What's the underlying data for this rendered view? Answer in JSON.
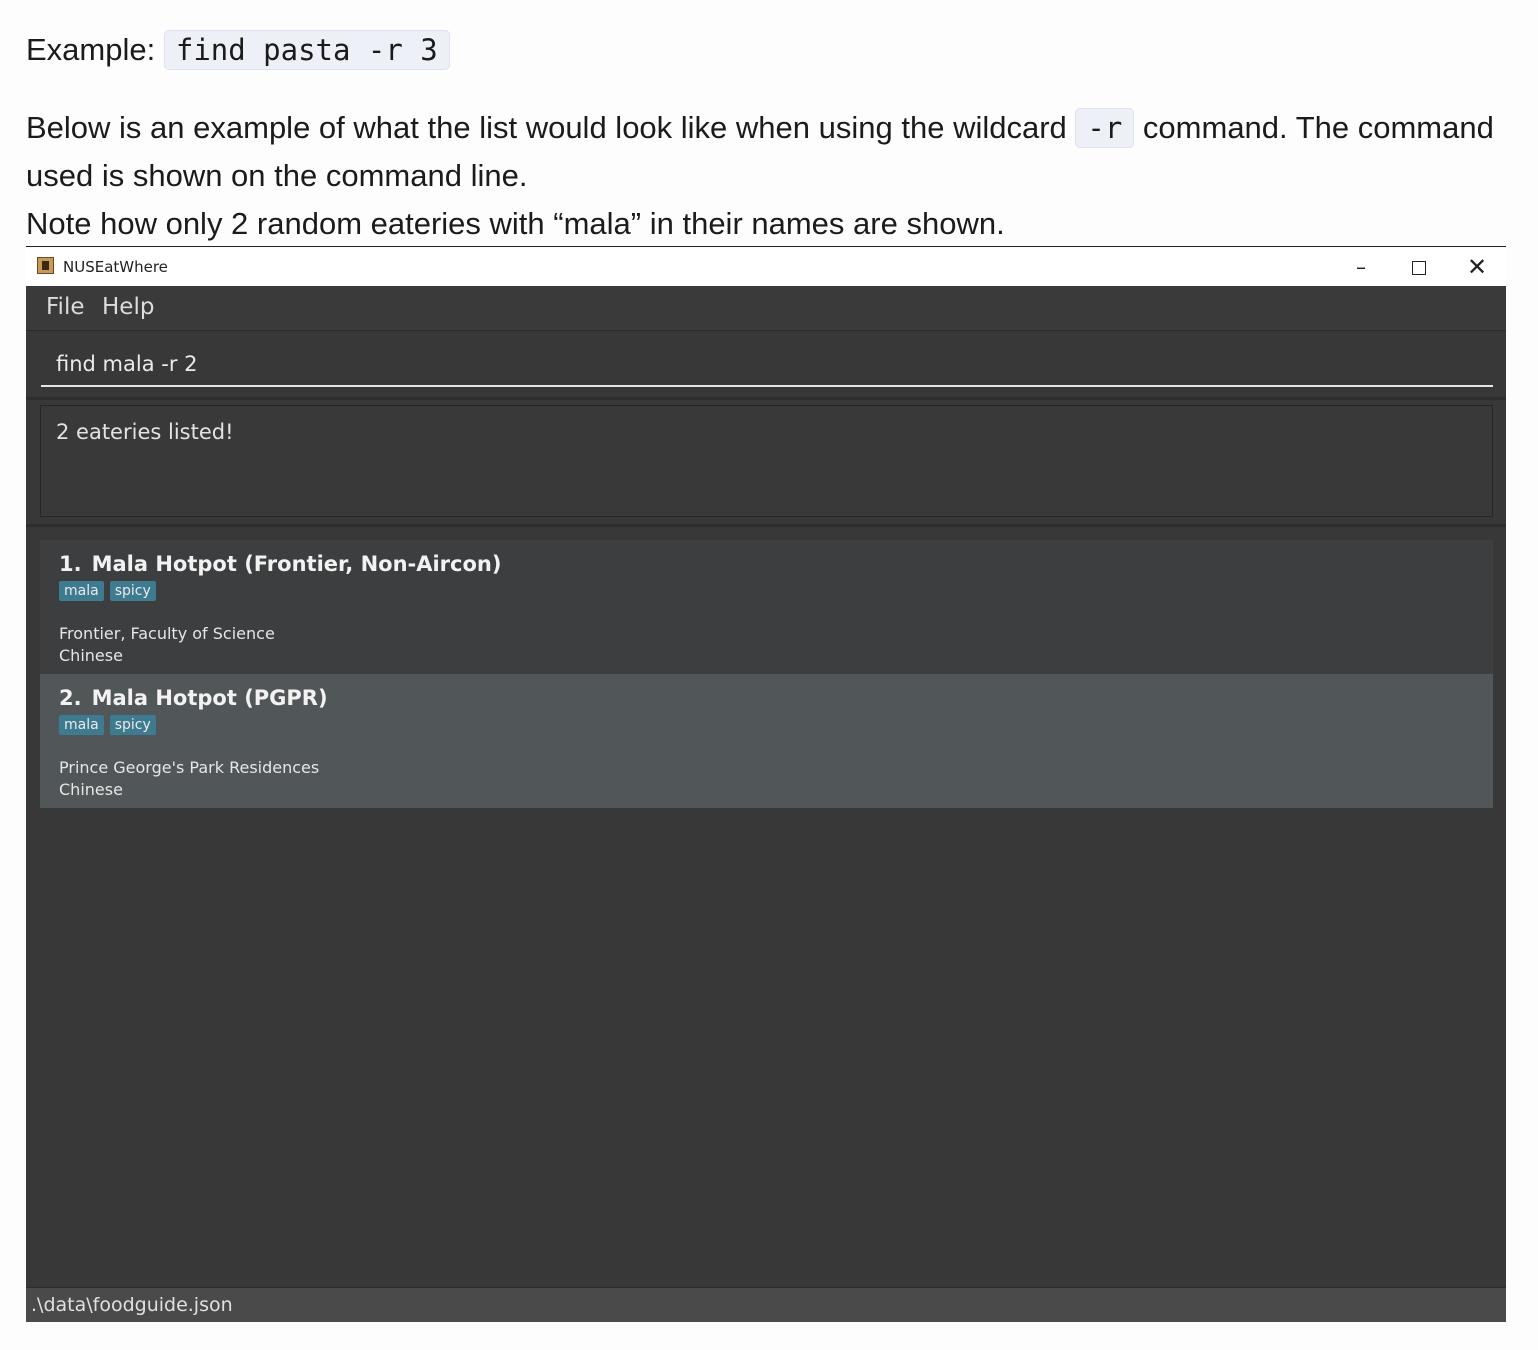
{
  "doc": {
    "example_label": "Example:",
    "example_code": "find pasta -r 3",
    "para_before_code": "Below is an example of what the list would look like when using the wildcard ",
    "para_code": "-r",
    "para_after_code": " command. The command used is shown on the command line.",
    "note": "Note how only 2 random eateries with “mala” in their names are shown."
  },
  "window": {
    "title": "NUSEatWhere",
    "controls": {
      "minimize": "–",
      "close": "✕"
    }
  },
  "menu": {
    "file": "File",
    "help": "Help"
  },
  "command": {
    "value": "find mala -r 2"
  },
  "result": {
    "text": "2 eateries listed!"
  },
  "eateries": [
    {
      "index": "1.",
      "name": "Mala Hotpot (Frontier, Non-Aircon)",
      "tags": [
        "mala",
        "spicy"
      ],
      "location": "Frontier, Faculty of Science",
      "cuisine": "Chinese"
    },
    {
      "index": "2.",
      "name": "Mala Hotpot (PGPR)",
      "tags": [
        "mala",
        "spicy"
      ],
      "location": "Prince George's Park Residences",
      "cuisine": "Chinese"
    }
  ],
  "status": {
    "path": ".\\data\\foodguide.json"
  },
  "colors": {
    "window_bg": "#383838",
    "card1_bg": "#3c3e3f",
    "card2_bg": "#515658",
    "tag_bg": "#3e7b91",
    "code_bg": "#eef0f8"
  }
}
